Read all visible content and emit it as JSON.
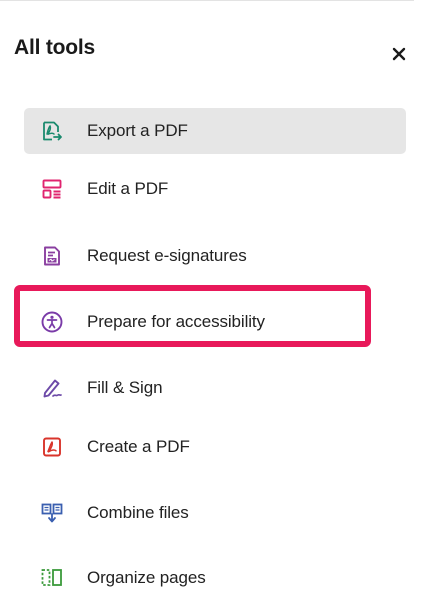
{
  "panel": {
    "title": "All tools",
    "close_glyph": "×"
  },
  "tools": [
    {
      "label": "Export a PDF",
      "icon": "export-pdf-icon",
      "color": "#1a8a6e",
      "selected": true
    },
    {
      "label": "Edit a PDF",
      "icon": "edit-pdf-icon",
      "color": "#e0246f",
      "selected": false
    },
    {
      "label": "Request e-signatures",
      "icon": "request-esign-icon",
      "color": "#8a3fa0",
      "selected": false
    },
    {
      "label": "Prepare for accessibility",
      "icon": "accessibility-icon",
      "color": "#7a3ba8",
      "selected": false,
      "highlighted": true
    },
    {
      "label": "Fill & Sign",
      "icon": "fill-sign-icon",
      "color": "#6d4aa8",
      "selected": false
    },
    {
      "label": "Create a PDF",
      "icon": "create-pdf-icon",
      "color": "#d9342b",
      "selected": false
    },
    {
      "label": "Combine files",
      "icon": "combine-files-icon",
      "color": "#3a5fb0",
      "selected": false
    },
    {
      "label": "Organize pages",
      "icon": "organize-pages-icon",
      "color": "#3b9a3b",
      "selected": false
    }
  ],
  "colors": {
    "selected_background": "#e6e6e6",
    "highlight_border": "#e8195a",
    "text": "#222222"
  }
}
